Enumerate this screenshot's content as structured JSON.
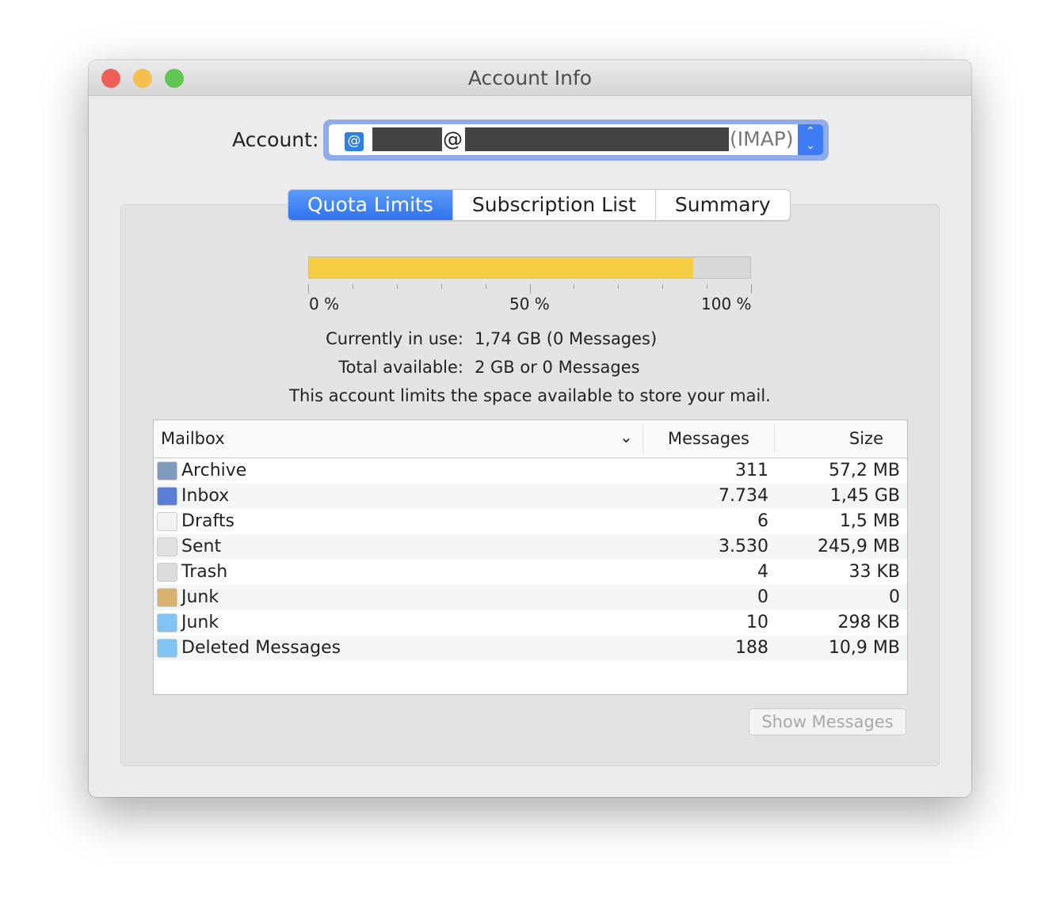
{
  "window": {
    "title": "Account Info",
    "traffic_lights": {
      "close": "#ed5f57",
      "minimize": "#f5bf4f",
      "zoom": "#61c554"
    }
  },
  "account": {
    "label": "Account:",
    "value_visible": "@",
    "type_suffix": "(IMAP)",
    "icon": "at-sign-icon"
  },
  "tabs": [
    {
      "label": "Quota Limits",
      "active": true
    },
    {
      "label": "Subscription List",
      "active": false
    },
    {
      "label": "Summary",
      "active": false
    }
  ],
  "quota": {
    "percent_used": 87,
    "fill_color": "#f6cc44",
    "scale_labels": [
      "0 %",
      "50 %",
      "100 %"
    ],
    "in_use_label": "Currently in use:",
    "in_use_value": "1,74 GB (0 Messages)",
    "total_label": "Total available:",
    "total_value": "2 GB or 0 Messages",
    "note": "This account limits the space available to store your mail."
  },
  "table": {
    "columns": [
      "Mailbox",
      "Messages",
      "Size"
    ],
    "rows": [
      {
        "icon": "archive-box-icon",
        "name": "Archive",
        "messages": "311",
        "size": "57,2 MB"
      },
      {
        "icon": "inbox-tray-icon",
        "name": "Inbox",
        "messages": "7.734",
        "size": "1,45 GB"
      },
      {
        "icon": "draft-document-icon",
        "name": "Drafts",
        "messages": "6",
        "size": "1,5 MB"
      },
      {
        "icon": "paper-plane-icon",
        "name": "Sent",
        "messages": "3.530",
        "size": "245,9 MB"
      },
      {
        "icon": "trash-can-icon",
        "name": "Trash",
        "messages": "4",
        "size": "33 KB"
      },
      {
        "icon": "junk-box-icon",
        "name": "Junk",
        "messages": "0",
        "size": "0"
      },
      {
        "icon": "folder-icon",
        "name": "Junk",
        "messages": "10",
        "size": "298 KB"
      },
      {
        "icon": "folder-icon",
        "name": "Deleted Messages",
        "messages": "188",
        "size": "10,9 MB"
      }
    ]
  },
  "show_messages_label": "Show Messages"
}
